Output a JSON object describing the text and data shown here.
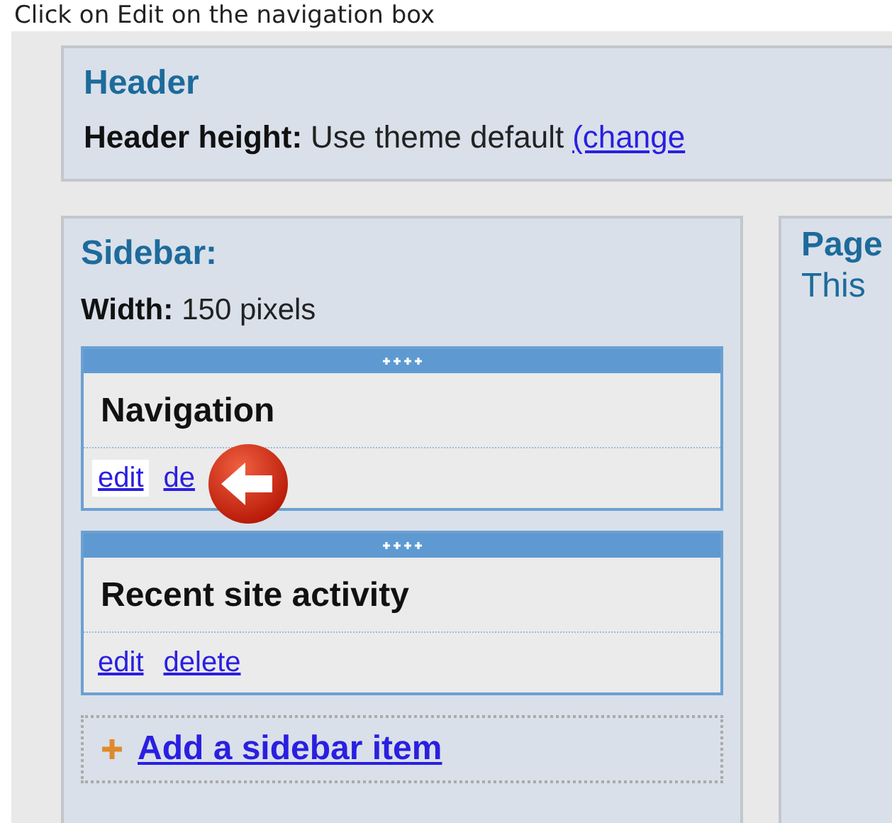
{
  "caption": "Click on Edit on the navigation box",
  "header": {
    "title": "Header",
    "label": "Header height:",
    "value": "Use theme default",
    "link": "(change"
  },
  "sidebar": {
    "title": "Sidebar:",
    "width_label": "Width:",
    "width_value": "150 pixels",
    "widgets": [
      {
        "title": "Navigation",
        "callout": true,
        "links": [
          {
            "text": "edit",
            "highlighted": true
          },
          {
            "text": "de",
            "highlighted": false
          }
        ]
      },
      {
        "title": "Recent site activity",
        "callout": false,
        "links": [
          {
            "text": "edit",
            "highlighted": false
          },
          {
            "text": "delete",
            "highlighted": false
          }
        ]
      }
    ],
    "add_link": "Add a sidebar item"
  },
  "page": {
    "title": "Page",
    "text": "This"
  }
}
